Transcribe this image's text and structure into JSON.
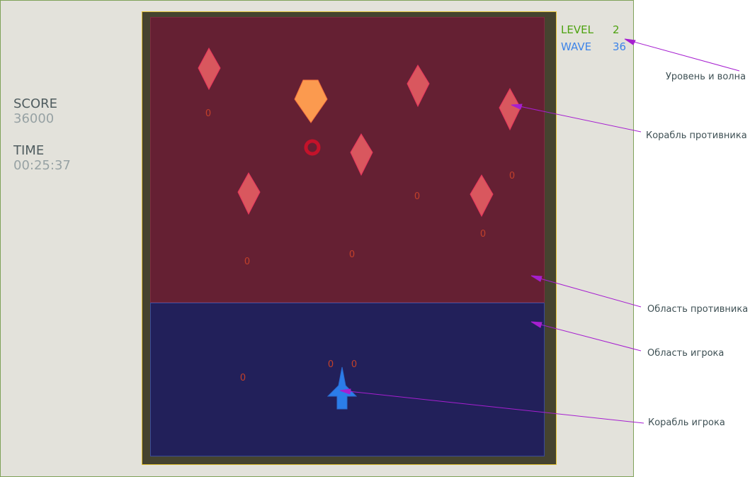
{
  "hud": {
    "score_label": "SCORE",
    "score_value": "36000",
    "time_label": "TIME",
    "time_value": "00:25:37",
    "level_label": "LEVEL",
    "level_value": "2",
    "wave_label": "WAVE",
    "wave_value": "36"
  },
  "annotations": {
    "level_wave": "Уровень и волна",
    "enemy_ship": "Корабль противника",
    "enemy_area": "Область противника",
    "player_area": "Область игрока",
    "player_ship": "Корабль игрока"
  },
  "colors": {
    "panel_bg": "#e3e2db",
    "frame": "#45432f",
    "frame_border": "#e2c135",
    "enemy_area": "#652033",
    "player_area": "#22205a",
    "enemy_ship": "#d9575e",
    "enemy_ship_stroke": "#e8335c",
    "boss_ship": "#fb9a4f",
    "player_ship": "#2b7de9",
    "bullet": "#c2402a",
    "level_green": "#4da20f",
    "wave_blue": "#3d84e8",
    "annotation_line": "#a61fd0"
  },
  "bullet_glyph": "0"
}
